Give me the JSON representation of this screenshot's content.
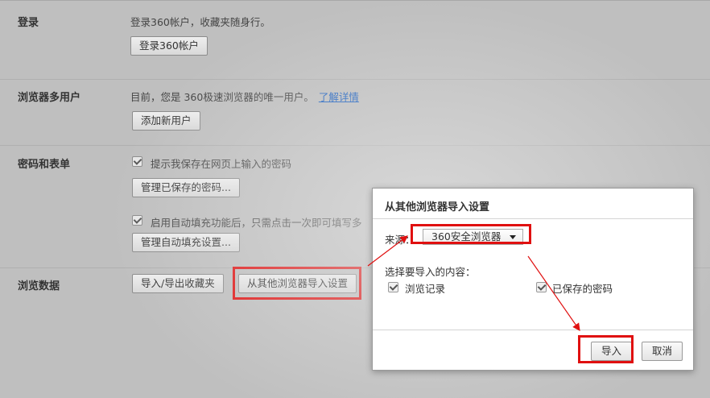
{
  "sections": {
    "login": {
      "label": "登录",
      "description": "登录360帐户，收藏夹随身行。",
      "button": "登录360帐户"
    },
    "multi_user": {
      "label": "浏览器多用户",
      "description": "目前，您是 360极速浏览器的唯一用户。",
      "link": "了解详情",
      "button": "添加新用户"
    },
    "passwords": {
      "label": "密码和表单",
      "offer_save": "提示我保存在网页上输入的密码",
      "manage_passwords": "管理已保存的密码...",
      "autofill": "启用自动填充功能后，只需点击一次即可填写多",
      "manage_autofill": "管理自动填充设置..."
    },
    "browsing_data": {
      "label": "浏览数据",
      "export_bookmarks": "导入/导出收藏夹",
      "import_from_other": "从其他浏览器导入设置"
    }
  },
  "dialog": {
    "title": "从其他浏览器导入设置",
    "source_label": "来源：",
    "source_value": "360安全浏览器",
    "items_label": "选择要导入的内容：",
    "item_history": "浏览记录",
    "item_passwords": "已保存的密码",
    "import_button": "导入",
    "cancel_button": "取消"
  },
  "colors": {
    "highlight": "#e01010",
    "link": "#1a5fbf"
  }
}
